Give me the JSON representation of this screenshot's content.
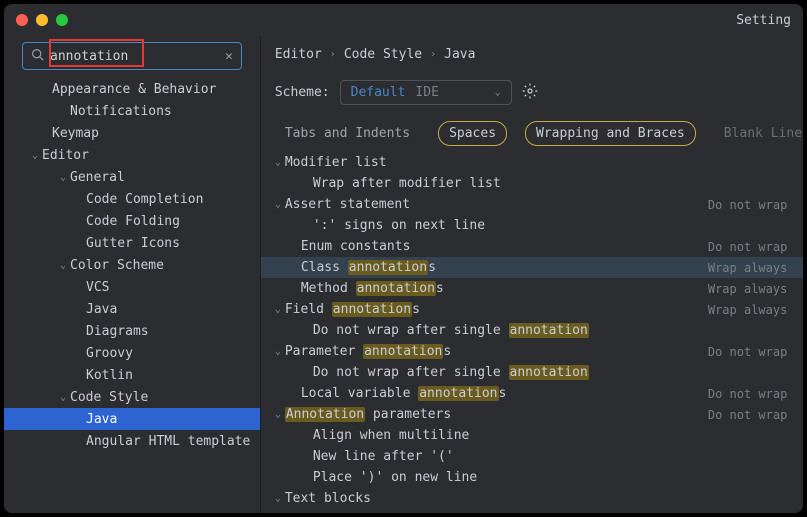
{
  "title_right": "Setting",
  "search": {
    "value": "annotation",
    "placeholder": ""
  },
  "sidebar": [
    {
      "label": "Appearance & Behavior",
      "indent": 34,
      "arrow": ""
    },
    {
      "label": "Notifications",
      "indent": 52,
      "arrow": ""
    },
    {
      "label": "Keymap",
      "indent": 34,
      "arrow": ""
    },
    {
      "label": "Editor",
      "indent": 24,
      "arrow": "v"
    },
    {
      "label": "General",
      "indent": 52,
      "arrow": "v"
    },
    {
      "label": "Code Completion",
      "indent": 68,
      "arrow": ""
    },
    {
      "label": "Code Folding",
      "indent": 68,
      "arrow": ""
    },
    {
      "label": "Gutter Icons",
      "indent": 68,
      "arrow": ""
    },
    {
      "label": "Color Scheme",
      "indent": 52,
      "arrow": "v"
    },
    {
      "label": "VCS",
      "indent": 68,
      "arrow": ""
    },
    {
      "label": "Java",
      "indent": 68,
      "arrow": ""
    },
    {
      "label": "Diagrams",
      "indent": 68,
      "arrow": ""
    },
    {
      "label": "Groovy",
      "indent": 68,
      "arrow": ""
    },
    {
      "label": "Kotlin",
      "indent": 68,
      "arrow": ""
    },
    {
      "label": "Code Style",
      "indent": 52,
      "arrow": "v"
    },
    {
      "label": "Java",
      "indent": 68,
      "arrow": "",
      "selected": true
    },
    {
      "label": "Angular HTML template",
      "indent": 68,
      "arrow": ""
    }
  ],
  "breadcrumb": [
    "Editor",
    "Code Style",
    "Java"
  ],
  "scheme": {
    "label": "Scheme:",
    "value": "Default",
    "ide": "IDE"
  },
  "tabs": [
    {
      "label": "Tabs and Indents",
      "state": ""
    },
    {
      "label": "Spaces",
      "state": "active"
    },
    {
      "label": "Wrapping and Braces",
      "state": "active"
    },
    {
      "label": "Blank Lines",
      "state": "blank"
    }
  ],
  "rows": [
    {
      "indent": 10,
      "arrow": "v",
      "pre": "Modifier list",
      "hl": "",
      "post": "",
      "status": "",
      "cb": ""
    },
    {
      "indent": 38,
      "arrow": "",
      "pre": "Wrap after modifier list",
      "hl": "",
      "post": "",
      "status": "",
      "cb": "off"
    },
    {
      "indent": 10,
      "arrow": "v",
      "pre": "Assert statement",
      "hl": "",
      "post": "",
      "status": "Do not wrap",
      "cb": ""
    },
    {
      "indent": 38,
      "arrow": "",
      "pre": "':' signs on next line",
      "hl": "",
      "post": "",
      "status": "",
      "cb": "off"
    },
    {
      "indent": 26,
      "arrow": "",
      "pre": "Enum constants",
      "hl": "",
      "post": "",
      "status": "Do not wrap",
      "cb": ""
    },
    {
      "indent": 26,
      "arrow": "",
      "pre": "Class ",
      "hl": "annotation",
      "post": "s",
      "status": "Wrap always",
      "cb": "",
      "sel": true
    },
    {
      "indent": 26,
      "arrow": "",
      "pre": "Method ",
      "hl": "annotation",
      "post": "s",
      "status": "Wrap always",
      "cb": ""
    },
    {
      "indent": 10,
      "arrow": "v",
      "pre": "Field ",
      "hl": "annotation",
      "post": "s",
      "status": "Wrap always",
      "cb": ""
    },
    {
      "indent": 38,
      "arrow": "",
      "pre": "Do not wrap after single ",
      "hl": "annotation",
      "post": "",
      "status": "",
      "cb": "on",
      "redbox": true
    },
    {
      "indent": 10,
      "arrow": "v",
      "pre": "Parameter ",
      "hl": "annotation",
      "post": "s",
      "status": "Do not wrap",
      "cb": ""
    },
    {
      "indent": 38,
      "arrow": "",
      "pre": "Do not wrap after single ",
      "hl": "annotation",
      "post": "",
      "status": "",
      "cb": "off"
    },
    {
      "indent": 26,
      "arrow": "",
      "pre": "Local variable ",
      "hl": "annotation",
      "post": "s",
      "status": "Do not wrap",
      "cb": ""
    },
    {
      "indent": 10,
      "arrow": "v",
      "pre": "",
      "hl": "Annotation",
      "post": " parameters",
      "status": "Do not wrap",
      "cb": ""
    },
    {
      "indent": 38,
      "arrow": "",
      "pre": "Align when multiline",
      "hl": "",
      "post": "",
      "status": "",
      "cb": "off"
    },
    {
      "indent": 38,
      "arrow": "",
      "pre": "New line after '('",
      "hl": "",
      "post": "",
      "status": "",
      "cb": "off"
    },
    {
      "indent": 38,
      "arrow": "",
      "pre": "Place ')' on new line",
      "hl": "",
      "post": "",
      "status": "",
      "cb": "off"
    },
    {
      "indent": 10,
      "arrow": "v",
      "pre": "Text blocks",
      "hl": "",
      "post": "",
      "status": "",
      "cb": ""
    }
  ]
}
